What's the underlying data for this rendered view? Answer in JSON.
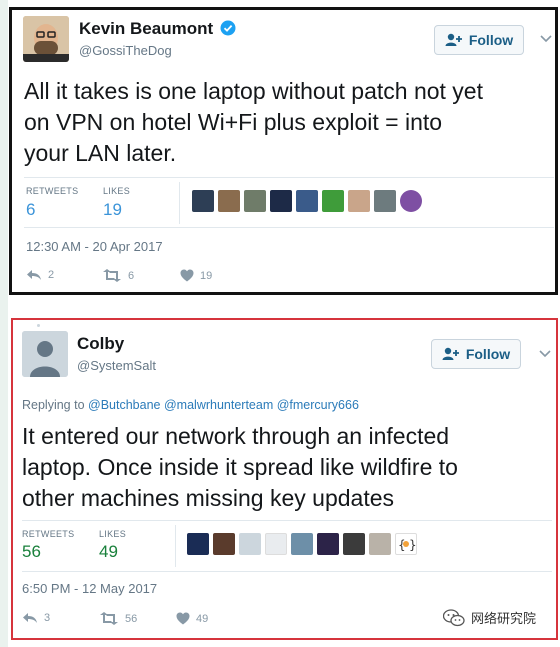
{
  "tweet1": {
    "name": "Kevin Beaumont",
    "handle": "@GossiTheDog",
    "follow_label": "Follow",
    "text_lines": [
      "All it takes is one laptop without patch not yet",
      "on VPN on hotel Wi+Fi plus exploit = into",
      "your LAN later."
    ],
    "retweets_label": "RETWEETS",
    "retweets_value": "6",
    "likes_label": "LIKES",
    "likes_value": "19",
    "timestamp": "12:30 AM - 20 Apr 2017",
    "reply_count": "2",
    "retweet_count": "6",
    "like_count": "19"
  },
  "tweet2": {
    "name": "Colby",
    "handle": "@SystemSalt",
    "follow_label": "Follow",
    "replying_prefix": "Replying to",
    "mentions": [
      "@Butchbane",
      "@malwrhunterteam",
      "@fmercury666"
    ],
    "text_lines": [
      "It entered our network through an infected",
      "laptop. Once inside it spread like wildfire to",
      "other machines missing key updates"
    ],
    "retweets_label": "RETWEETS",
    "retweets_value": "56",
    "likes_label": "LIKES",
    "likes_value": "49",
    "timestamp": "6:50 PM - 12 May 2017",
    "reply_count": "3",
    "retweet_count": "56",
    "like_count": "49"
  },
  "watermark": "网络研究院",
  "colors": {
    "retweet_value_blue": "#3b94d9",
    "retweet_value_green": "#19803b",
    "verified_blue": "#1da1f2",
    "border_red": "#d6343c"
  },
  "icons": [
    "verified-badge-icon",
    "follow-person-plus-icon",
    "chevron-down-icon",
    "reply-icon",
    "retweet-icon",
    "heart-icon",
    "wechat-icon"
  ]
}
